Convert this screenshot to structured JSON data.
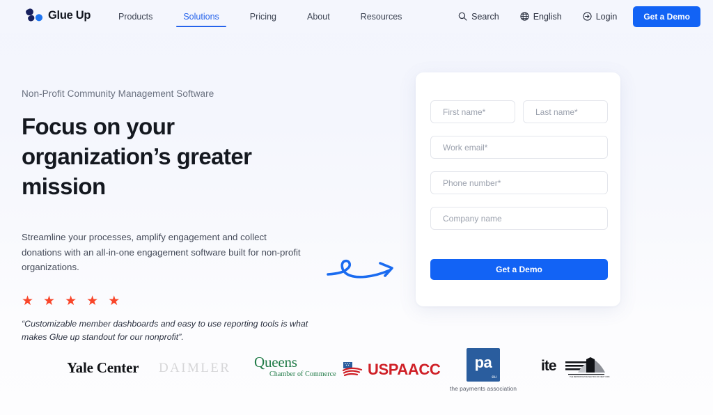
{
  "brand": {
    "name": "Glue Up",
    "logo_icon": "glueup-logo-icon",
    "mark_color_dark": "#17205e",
    "mark_color_blue": "#1e74f0"
  },
  "header": {
    "nav": [
      {
        "label": "Products",
        "active": false
      },
      {
        "label": "Solutions",
        "active": true
      },
      {
        "label": "Pricing",
        "active": false
      },
      {
        "label": "About",
        "active": false
      },
      {
        "label": "Resources",
        "active": false
      }
    ],
    "search": {
      "label": "Search",
      "icon": "search-icon"
    },
    "language": {
      "label": "English",
      "icon": "globe-icon"
    },
    "login": {
      "label": "Login",
      "icon": "login-arrow-icon"
    },
    "cta": {
      "label": "Get a Demo",
      "color": "#1263f5"
    },
    "accent_color": "#2563eb"
  },
  "hero": {
    "eyebrow": "Non-Profit Community Management Software",
    "title": "Focus on your organization’s greater mission",
    "description": "Streamline your processes, amplify engagement and collect donations with an all-in-one engagement software built for non-profit organizations.",
    "rating": {
      "stars": 5,
      "glyph": "★",
      "color": "#f9462a"
    },
    "quote": "“Customizable member dashboards and easy to use reporting tools is what makes Glue up standout for our nonprofit”.",
    "arrow_icon": "curved-arrow-icon",
    "arrow_color": "#1a6bf0"
  },
  "form": {
    "fields": [
      {
        "name": "first-name",
        "placeholder": "First name*",
        "value": ""
      },
      {
        "name": "last-name",
        "placeholder": "Last name*",
        "value": ""
      },
      {
        "name": "work-email",
        "placeholder": "Work email*",
        "value": ""
      },
      {
        "name": "phone-number",
        "placeholder": "Phone number*",
        "value": ""
      },
      {
        "name": "company-name",
        "placeholder": "Company name",
        "value": ""
      }
    ],
    "submit": {
      "label": "Get a Demo",
      "color": "#1263f5"
    }
  },
  "logos": [
    {
      "name": "yale-center",
      "text": "Yale Center"
    },
    {
      "name": "daimler",
      "text": "DAIMLER"
    },
    {
      "name": "queens-chamber-of-commerce",
      "text": "Queens",
      "subtext": "Chamber of Commerce"
    },
    {
      "name": "uspaacc",
      "text": "USPAACC"
    },
    {
      "name": "the-payments-association",
      "text": "pa",
      "superscript": "eu",
      "subtext": "the payments association"
    },
    {
      "name": "ite-metropolitan-section",
      "text": "ite",
      "subtext": "THE METROPOLITAN SECTION OF NEW YORK & NEW JERSEY"
    }
  ]
}
